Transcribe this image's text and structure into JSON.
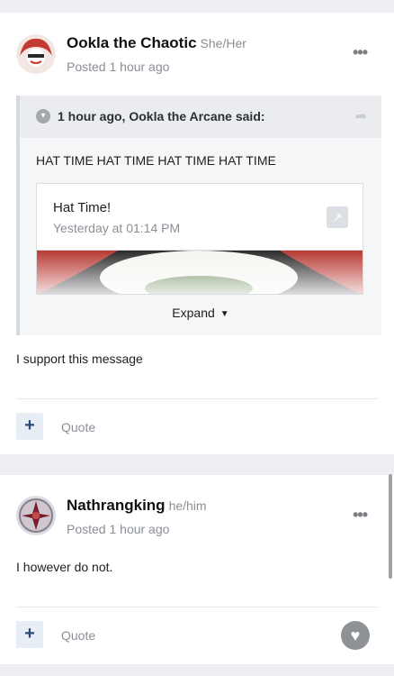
{
  "posts": [
    {
      "author": "Ookla the Chaotic",
      "pronouns": "She/Her",
      "posted": "Posted 1 hour ago",
      "quote": {
        "citation": "1 hour ago, Ookla the Arcane said:",
        "text": "HAT TIME HAT TIME HAT TIME HAT TIME",
        "embed": {
          "title": "Hat Time!",
          "date": "Yesterday at 01:14 PM"
        },
        "expand_label": "Expand"
      },
      "body": "I support this message",
      "quote_label": "Quote",
      "plus_label": "+"
    },
    {
      "author": "Nathrangking",
      "pronouns": "he/him",
      "posted": "Posted 1 hour ago",
      "body": "I however do not.",
      "quote_label": "Quote",
      "plus_label": "+"
    }
  ],
  "icons": {
    "more": "ellipsis-icon",
    "chevron": "chevron-down-icon",
    "share": "share-icon",
    "external": "external-link-icon",
    "heart": "heart-icon"
  },
  "colors": {
    "background": "#edeff2",
    "accent": "#2c4a73",
    "muted": "#8a8f96"
  }
}
